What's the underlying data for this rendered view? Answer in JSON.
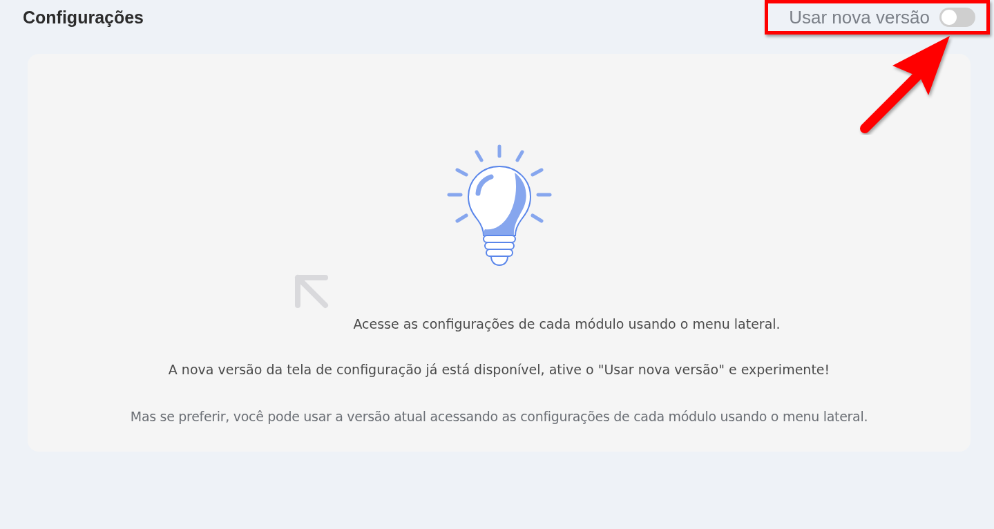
{
  "header": {
    "title": "Configurações"
  },
  "toggle": {
    "label": "Usar nova versão",
    "on": false
  },
  "messages": [
    {
      "kind": "hint",
      "text": "Acesse as configurações de cada módulo usando o menu lateral."
    },
    {
      "kind": "notice",
      "text": "A nova versão da tela de configuração já está disponível, ative o \"Usar nova versão\" e experimente!"
    },
    {
      "kind": "footnote",
      "text": "Mas se preferir, você pode usar a versão atual acessando as configurações de cada módulo usando o menu lateral."
    }
  ]
}
